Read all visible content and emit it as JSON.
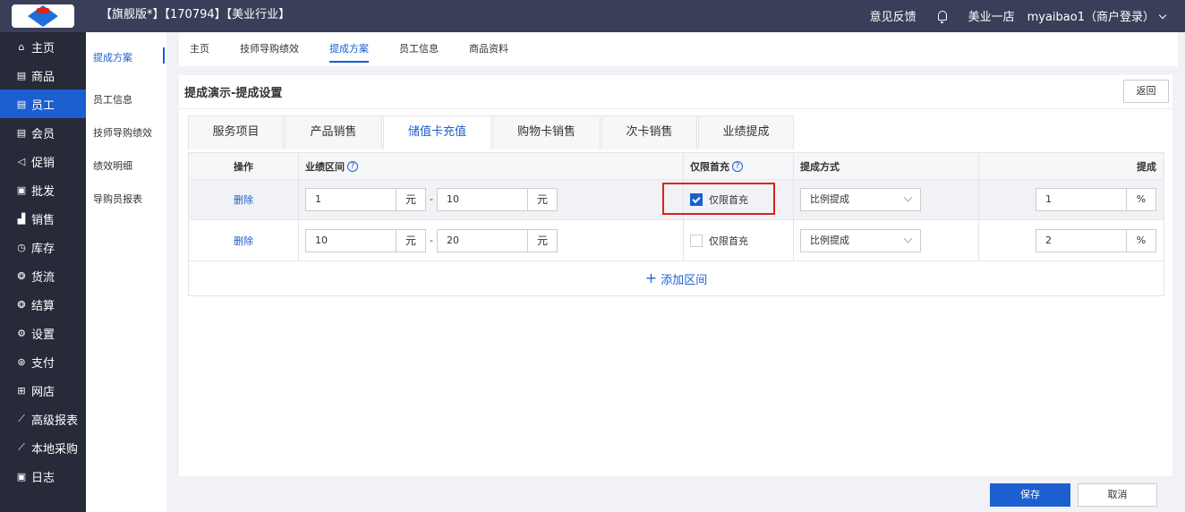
{
  "header": {
    "title": "【旗舰版*】【170794】【美业行业】",
    "feedback": "意见反馈",
    "store": "美业一店",
    "user": "myaibao1（商户登录）"
  },
  "sidebar": {
    "items": [
      {
        "label": "主页",
        "icon": "home-icon",
        "glyph": "⌂"
      },
      {
        "label": "商品",
        "icon": "goods-icon",
        "glyph": "▤"
      },
      {
        "label": "员工",
        "icon": "staff-icon",
        "glyph": "▤"
      },
      {
        "label": "会员",
        "icon": "member-icon",
        "glyph": "▤"
      },
      {
        "label": "促销",
        "icon": "promo-icon",
        "glyph": "◁"
      },
      {
        "label": "批发",
        "icon": "wholesale-icon",
        "glyph": "▣"
      },
      {
        "label": "销售",
        "icon": "sales-icon",
        "glyph": "▟"
      },
      {
        "label": "库存",
        "icon": "inventory-icon",
        "glyph": "◷"
      },
      {
        "label": "货流",
        "icon": "flow-icon",
        "glyph": "❂"
      },
      {
        "label": "结算",
        "icon": "settle-icon",
        "glyph": "❂"
      },
      {
        "label": "设置",
        "icon": "settings-icon",
        "glyph": "⚙"
      },
      {
        "label": "支付",
        "icon": "pay-icon",
        "glyph": "⊛"
      },
      {
        "label": "网店",
        "icon": "shop-icon",
        "glyph": "⊞"
      },
      {
        "label": "高级报表",
        "icon": "report-icon",
        "glyph": "⟋"
      },
      {
        "label": "本地采购",
        "icon": "purchase-icon",
        "glyph": "⟋"
      },
      {
        "label": "日志",
        "icon": "log-icon",
        "glyph": "▣"
      }
    ],
    "active_index": 2
  },
  "subnav": {
    "items": [
      "提成方案",
      "员工信息",
      "技师导购绩效",
      "绩效明细",
      "导购员报表"
    ]
  },
  "tabs": {
    "items": [
      "主页",
      "技师导购绩效",
      "提成方案",
      "员工信息",
      "商品资料"
    ]
  },
  "panel": {
    "title": "提成演示-提成设置",
    "back": "返回"
  },
  "categories": {
    "items": [
      "服务项目",
      "产品销售",
      "储值卡充值",
      "购物卡销售",
      "次卡销售",
      "业绩提成"
    ]
  },
  "table": {
    "headers": {
      "op": "操作",
      "range": "业绩区间",
      "first_only": "仅限首充",
      "method": "提成方式",
      "rate": "提成"
    },
    "rows": [
      {
        "op": "删除",
        "from": "1",
        "to": "10",
        "unit": "元",
        "first_only": true,
        "first_label": "仅限首充",
        "method": "比例提成",
        "rate": "1",
        "rate_unit": "%"
      },
      {
        "op": "删除",
        "from": "10",
        "to": "20",
        "unit": "元",
        "first_only": false,
        "first_label": "仅限首充",
        "method": "比例提成",
        "rate": "2",
        "rate_unit": "%"
      }
    ],
    "dash": "-",
    "add_label": "添加区间"
  },
  "footer": {
    "save": "保存",
    "cancel": "取消"
  },
  "colors": {
    "accent": "#1b5fd0",
    "topbar": "#3a3f59",
    "sidebar": "#262a39",
    "highlight": "#e02020"
  }
}
